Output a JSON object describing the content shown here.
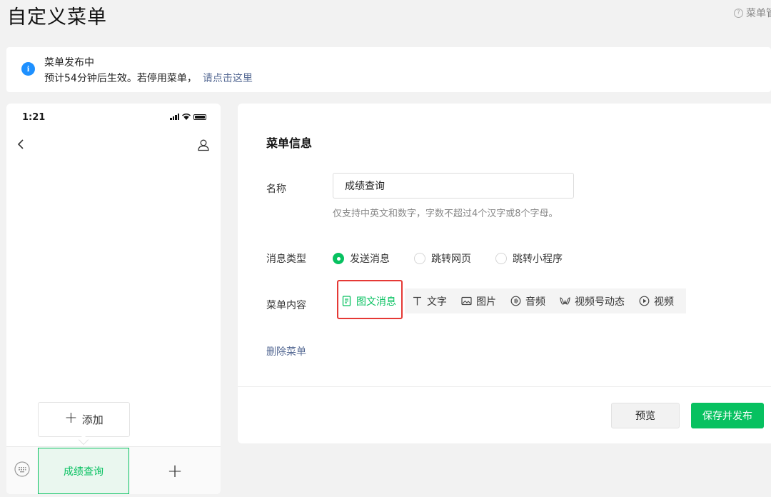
{
  "page": {
    "title": "自定义菜单",
    "help_link": "菜单管理"
  },
  "notice": {
    "title": "菜单发布中",
    "body": "预计54分钟后生效。若停用菜单，",
    "link": "请点击这里",
    "icon": "info-icon",
    "icon_glyph": "i"
  },
  "phone": {
    "status_time": "1:21",
    "add_button_label": "添加",
    "menu_items": [
      "成绩查询"
    ],
    "add_menu_glyph": "+"
  },
  "editor": {
    "section_title": "菜单信息",
    "name_label": "名称",
    "name_value": "成绩查询",
    "name_hint": "仅支持中英文和数字，字数不超过4个汉字或8个字母。",
    "message_type_label": "消息类型",
    "message_types": [
      {
        "label": "发送消息",
        "selected": true
      },
      {
        "label": "跳转网页",
        "selected": false
      },
      {
        "label": "跳转小程序",
        "selected": false
      }
    ],
    "content_label": "菜单内容",
    "content_types": [
      {
        "label": "图文消息",
        "icon": "article-icon",
        "active": true
      },
      {
        "label": "文字",
        "icon": "text-icon",
        "active": false
      },
      {
        "label": "图片",
        "icon": "image-icon",
        "active": false
      },
      {
        "label": "音频",
        "icon": "audio-icon",
        "active": false
      },
      {
        "label": "视频号动态",
        "icon": "channels-icon",
        "active": false
      },
      {
        "label": "视频",
        "icon": "video-icon",
        "active": false
      }
    ],
    "delete_label": "删除菜单",
    "preview_button": "预览",
    "save_button": "保存并发布"
  },
  "colors": {
    "accent_green": "#07c160",
    "link_blue": "#576b95",
    "info_blue": "#1e90ff",
    "highlight_red": "#e53935"
  }
}
